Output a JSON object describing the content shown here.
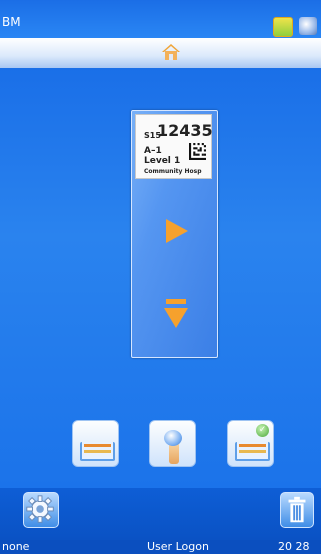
{
  "status_bar": {
    "title": "BM",
    "icons": [
      "cassette-icon",
      "people-icon"
    ]
  },
  "header": {
    "home_icon": "home-icon"
  },
  "cassette": {
    "prefix": "S15",
    "number": "12435",
    "slot": "A–1",
    "level": "Level 1",
    "hospital": "Community Hosp",
    "play_icon": "play-icon",
    "eject_icon": "eject-down-icon"
  },
  "actions": [
    {
      "name": "tray-icon"
    },
    {
      "name": "hand-touch-icon"
    },
    {
      "name": "tray-check-icon"
    }
  ],
  "footer": {
    "settings_icon": "gear-icon",
    "delete_icon": "trash-icon"
  },
  "bottom_status": {
    "left": "none",
    "center": "User Logon",
    "right": "20 28"
  },
  "colors": {
    "background": "#1a6fe8",
    "accent": "#f6a12d"
  }
}
